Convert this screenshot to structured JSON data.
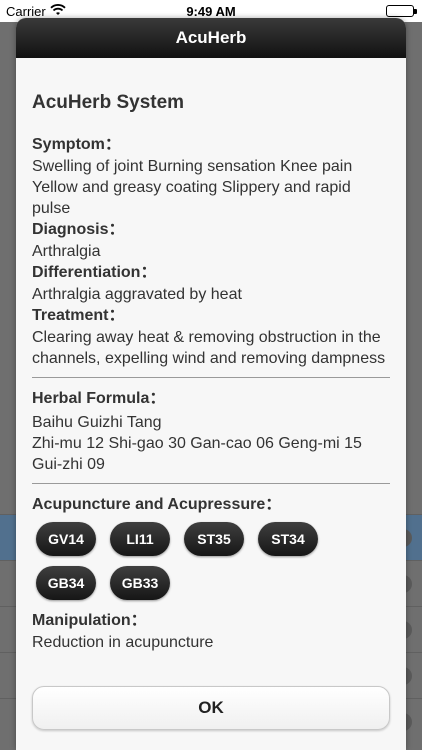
{
  "status_bar": {
    "carrier": "Carrier",
    "time": "9:49 AM"
  },
  "dialog": {
    "title": "AcuHerb",
    "system_title": "AcuHerb System",
    "symptom": {
      "label": "Symptom：",
      "value": "Swelling of joint Burning sensation Knee pain Yellow and greasy coating Slippery and rapid pulse"
    },
    "diagnosis": {
      "label": "Diagnosis：",
      "value": "Arthralgia"
    },
    "differentiation": {
      "label": "Differentiation：",
      "value": "Arthralgia aggravated by heat"
    },
    "treatment": {
      "label": "Treatment：",
      "value": "Clearing away heat & removing obstruction in the channels, expelling wind and removing dampness"
    },
    "herbal_formula": {
      "label": "Herbal Formula：",
      "name": "Baihu Guizhi Tang",
      "ingredients": "Zhi-mu 12 Shi-gao 30 Gan-cao 06 Geng-mi 15 Gui-zhi 09"
    },
    "acupuncture": {
      "label": "Acupuncture and Acupressure：",
      "points": [
        "GV14",
        "LI11",
        "ST35",
        "ST34",
        "GB34",
        "GB33"
      ]
    },
    "manipulation": {
      "label": "Manipulation：",
      "value": "Reduction in acupuncture"
    },
    "ok_label": "OK"
  }
}
